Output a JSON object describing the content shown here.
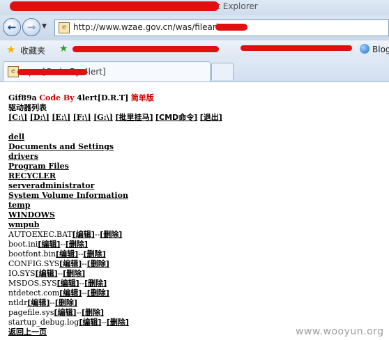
{
  "browser": {
    "window_title": "…p… X…G…(… By 4lert[… … Windows Internet Explorer",
    "address": "http://www.wzae.gov.cn/was/fileark/",
    "favorites_label": "收藏夹",
    "fav_right": "Blog",
    "tab_title": "…p…[Code By 4lert]"
  },
  "header": {
    "prefix": "Gif89a",
    "code_by": "Code By",
    "author": "4lert[D.R.T]",
    "edition": "简单版",
    "drive_title": "驱动器列表"
  },
  "drives": [
    "[C:\\]",
    "[D:\\]",
    "[E:\\]",
    "[F:\\]",
    "[G:\\]",
    "[批里挂马]",
    "[CMD命令]",
    "[退出]"
  ],
  "folders": [
    "dell",
    "Documents and Settings",
    "drivers",
    "Program Files",
    "RECYCLER",
    "serveradministrator",
    "System Volume Information",
    "temp",
    "WINDOWS",
    "wmpub"
  ],
  "files": {
    "edit_label": "[编辑]",
    "sep": "--",
    "delete_label": "[删除]",
    "names": [
      "AUTOEXEC.BAT",
      "boot.ini",
      "bootfont.bin",
      "CONFIG.SYS",
      "IO.SYS",
      "MSDOS.SYS",
      "ntdetect.com",
      "ntldr",
      "pagefile.sys",
      "startup_debug.log"
    ]
  },
  "back_link": "返回上一页",
  "watermark": "www.wooyun.org"
}
